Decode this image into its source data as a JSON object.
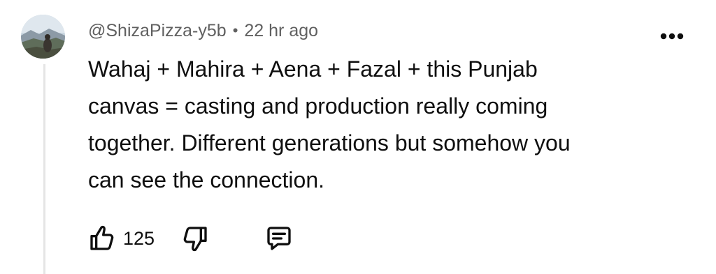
{
  "comment": {
    "author": "@ShizaPizza-y5b",
    "separator": "•",
    "timestamp": "22 hr ago",
    "text": "Wahaj + Mahira + Aena + Fazal + this Punjab canvas = casting and production really coming together. Different generations but somehow you can see the connection.",
    "lines": [
      "Wahaj + Mahira + Aena + Fazal + this Punjab",
      "canvas = casting and production really coming",
      "together. Different generations but somehow you",
      "can see the connection."
    ],
    "like_count": "125"
  },
  "icons": {
    "avatar": "user-avatar",
    "more": "more-options-icon",
    "like": "thumbs-up-icon",
    "dislike": "thumbs-down-icon",
    "reply": "comment-reply-icon"
  },
  "colors": {
    "text": "#0f0f0f",
    "meta": "#606060",
    "thread_line": "#e5e5e5"
  }
}
